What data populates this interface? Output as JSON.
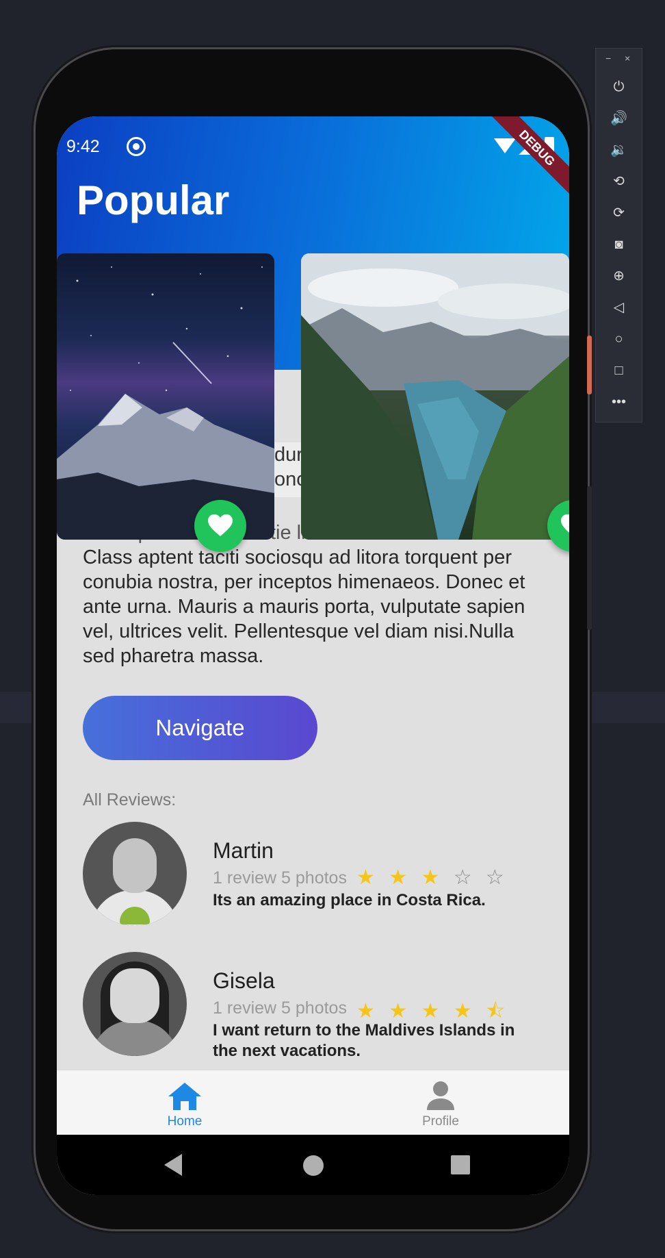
{
  "status_bar": {
    "time": "9:42",
    "debug_banner": "DEBUG"
  },
  "header": {
    "title": "Popular"
  },
  "cards": [
    {
      "name": "Night sky over snowy mountains",
      "favorited": true
    },
    {
      "name": "Lake between forested mountains",
      "favorited": true
    }
  ],
  "description": {
    "peek_line1": "dur",
    "peek_line2": "onc",
    "partial_line": "Morbi pharetra molestie libero nec accumsan.",
    "text": "Class aptent taciti sociosqu ad litora torquent per conubia nostra, per inceptos himenaeos. Donec et ante urna. Mauris a mauris porta, vulputate sapien vel, ultrices velit. Pellentesque vel diam nisi.Nulla sed pharetra massa."
  },
  "navigate_button": {
    "label": "Navigate"
  },
  "reviews": {
    "label": "All Reviews:",
    "items": [
      {
        "name": "Martin",
        "meta": "1 review 5 photos",
        "rating": 3,
        "stars_filled": "★ ★ ★",
        "stars_empty": " ☆ ☆",
        "text": "Its an amazing place in Costa Rica."
      },
      {
        "name": "Gisela",
        "meta": "1 review 5 photos",
        "rating": 4.5,
        "stars_filled": "★ ★ ★ ★",
        "stars_empty": " ⯪",
        "text": "I want return to the Maldives Islands in the next vacations."
      }
    ]
  },
  "tabs": [
    {
      "label": "Home",
      "active": true,
      "icon": "home-icon"
    },
    {
      "label": "Profile",
      "active": false,
      "icon": "person-icon"
    }
  ],
  "colors": {
    "header_gradient_start": "#0b3fc2",
    "header_gradient_end": "#02a8ea",
    "accent_blue": "#1e88e5",
    "fav_green": "#21c45a",
    "star_gold": "#f5c518",
    "navigate_gradient_start": "#4670da",
    "navigate_gradient_end": "#5a48d0"
  },
  "emulator_toolbar": {
    "minimize": "−",
    "close": "×",
    "more": "•••"
  }
}
